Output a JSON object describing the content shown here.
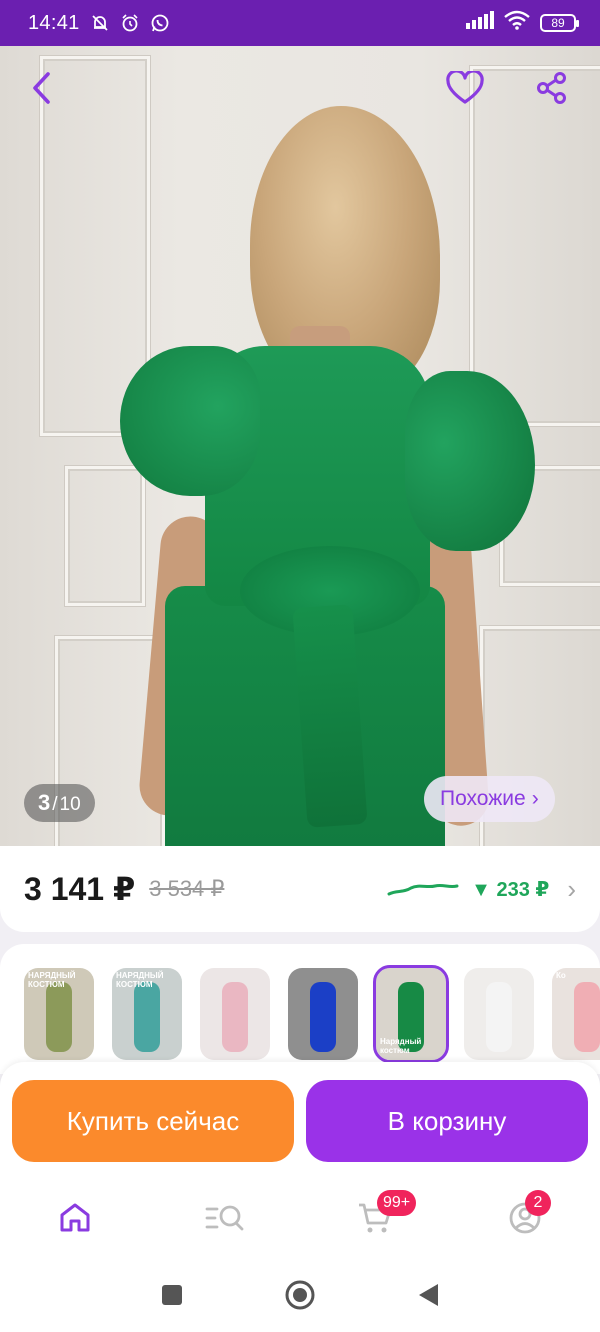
{
  "status_bar": {
    "time": "14:41",
    "battery": "89",
    "icons": [
      "bell-off-icon",
      "alarm-icon",
      "whatsapp-icon",
      "signal-icon",
      "wifi-icon",
      "battery-icon"
    ]
  },
  "colors": {
    "accent": "#8a3be0",
    "buy": "#fb8a2c",
    "cart": "#9a32e8",
    "price_drop": "#1fa65a",
    "badge": "#f0245c",
    "status_bar": "#6b1fb0"
  },
  "gallery": {
    "current": "3",
    "separator": "/",
    "total": "10",
    "similar_label": "Похожие",
    "similar_chevron": "›"
  },
  "price": {
    "current": "3 141 ₽",
    "old": "3 534 ₽",
    "drop": "▼ 233 ₽",
    "chevron": "›"
  },
  "thumbnails": [
    {
      "caption": "НАРЯДНЫЙ КОСТЮМ",
      "bg": "#cfc9b8",
      "fig": "#8c9a5a",
      "active": false
    },
    {
      "caption": "НАРЯДНЫЙ КОСТЮМ",
      "bg": "#c9d0cf",
      "fig": "#4aa6a2",
      "active": false
    },
    {
      "caption": "",
      "bg": "#ece6e6",
      "fig": "#eab7c2",
      "active": false
    },
    {
      "caption": "",
      "bg": "#8f8f8f",
      "fig": "#1b3fc6",
      "active": false
    },
    {
      "caption": "Нарядный костюм",
      "bg": "#d9d4cc",
      "fig": "#178a45",
      "active": true
    },
    {
      "caption": "",
      "bg": "#efedeb",
      "fig": "#f4f4f4",
      "active": false
    },
    {
      "caption": "Ко",
      "bg": "#e9e2de",
      "fig": "#f0aeb4",
      "active": false
    }
  ],
  "actions": {
    "buy_now": "Купить сейчас",
    "add_to_cart": "В корзину"
  },
  "bottom_nav": {
    "items": [
      {
        "name": "home",
        "icon": "home-icon",
        "active": true
      },
      {
        "name": "catalog",
        "icon": "catalog-search-icon",
        "active": false
      },
      {
        "name": "cart",
        "icon": "cart-icon",
        "badge": "99+"
      },
      {
        "name": "profile",
        "icon": "profile-icon",
        "badge": "2"
      }
    ]
  },
  "system_nav": [
    "recents-icon",
    "home-circle-icon",
    "back-icon"
  ]
}
